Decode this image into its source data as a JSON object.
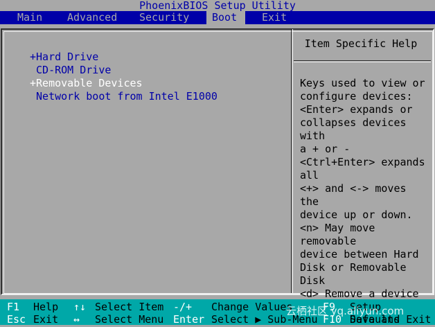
{
  "title": "PhoenixBIOS Setup Utility",
  "menu": [
    {
      "label": "Main",
      "active": false
    },
    {
      "label": "Advanced",
      "active": false
    },
    {
      "label": "Security",
      "active": false
    },
    {
      "label": "Boot",
      "active": true
    },
    {
      "label": "Exit",
      "active": false
    }
  ],
  "boot_items": [
    {
      "label": "+Hard Drive",
      "selected": false
    },
    {
      "label": " CD-ROM Drive",
      "selected": false
    },
    {
      "label": "+Removable Devices",
      "selected": true
    },
    {
      "label": " Network boot from Intel E1000",
      "selected": false
    }
  ],
  "help": {
    "title": "Item Specific Help",
    "text": "Keys used to view or\nconfigure devices:\n<Enter> expands or\ncollapses devices with\na + or -\n<Ctrl+Enter> expands\nall\n<+> and <-> moves the\ndevice up or down.\n<n> May move removable\ndevice between Hard\nDisk or Removable Disk\n<d> Remove a device\nthat is not installed."
  },
  "footer": {
    "row1": [
      {
        "key": "F1",
        "action": "Help"
      },
      {
        "key": "↑↓",
        "action": "Select Item"
      },
      {
        "key": "-/+",
        "action": "Change Values"
      },
      {
        "key": "F9",
        "action": "Setup Defaults"
      }
    ],
    "row2": [
      {
        "key": "Esc",
        "action": "Exit"
      },
      {
        "key": "↔",
        "action": "Select Menu"
      },
      {
        "key": "Enter",
        "action": "Select ▶ Sub-Menu"
      },
      {
        "key": "F10",
        "action": "Save and Exit"
      }
    ]
  },
  "watermark": "云栖社区 yq.aliyun.com",
  "colors": {
    "background": "#a8a8a8",
    "menubar": "#0000a8",
    "footer": "#00a8a8",
    "selected_text": "#ffffff"
  }
}
